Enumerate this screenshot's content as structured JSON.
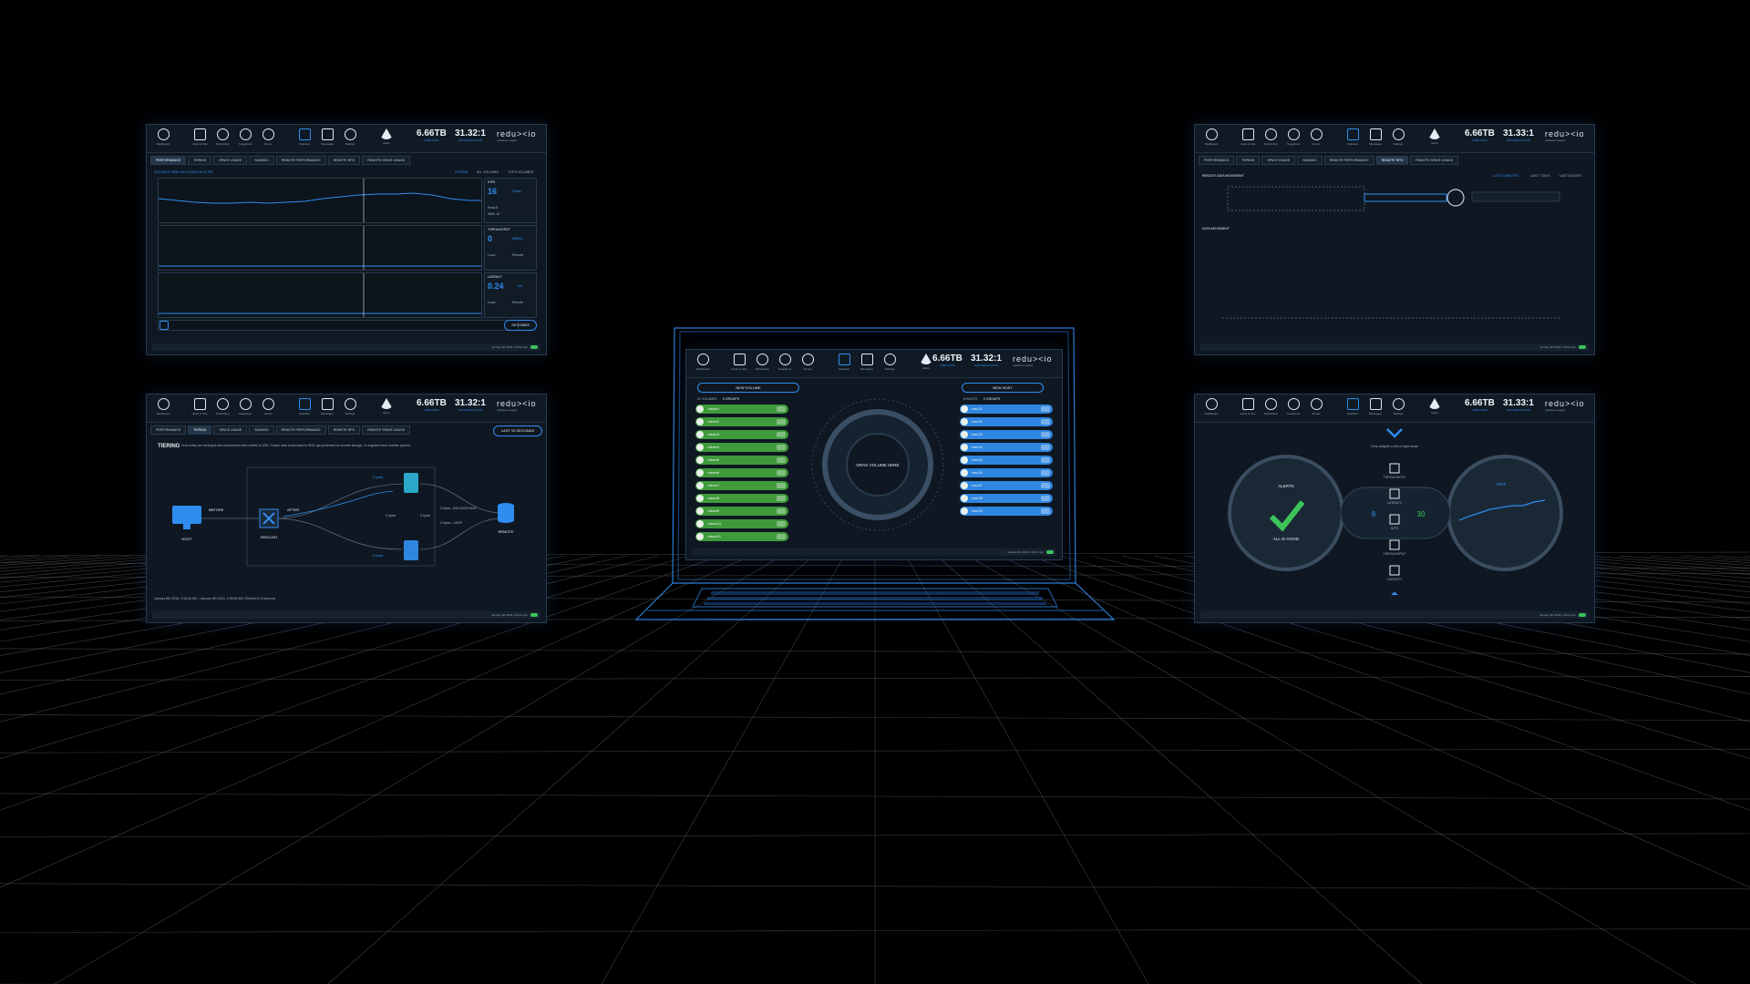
{
  "header": {
    "nav": [
      {
        "label": "Dashboard",
        "icon": "info-icon"
      },
      {
        "label": "Hosts & Vols",
        "icon": "monitor-icon"
      },
      {
        "label": "Scheduling",
        "icon": "clock-icon"
      },
      {
        "label": "Snapshots",
        "icon": "snapshot-icon"
      },
      {
        "label": "Clones",
        "icon": "clone-icon"
      },
      {
        "label": "Statistics",
        "icon": "stats-icon"
      },
      {
        "label": "Messages",
        "icon": "list-icon"
      },
      {
        "label": "Settings",
        "icon": "gear-icon"
      },
      {
        "label": "Alerts",
        "icon": "warning-icon"
      }
    ],
    "capacity_value": "6.66",
    "capacity_unit": "TB",
    "capacity_label": "USED DATA",
    "reduction_value": "31.32:1",
    "reduction_value_alt": "31.33:1",
    "reduction_label": "DATA REDUCTION",
    "brand": "redu><io",
    "user": "reduxio ▸ Logout"
  },
  "tabs": [
    "PERFORMANCE",
    "TIERING",
    "SPACE USAGE",
    "SAVINGS",
    "REMOTE PERFORMANCE",
    "REMOTE RPO",
    "REMOTE SPACE USAGE"
  ],
  "footer": {
    "timestamp": "January 8th 2018, 2:36:41 pm"
  },
  "perf_panel": {
    "subhead": "SECONDS VIEW   Jan 8 2018   2:36:11 PM",
    "filters": [
      "SYSTEM",
      "ALL VOLUMES",
      "TOP 5 VOLUMES"
    ],
    "charts": [
      {
        "title": "IOPS",
        "unit": "IO/sec",
        "value": "16",
        "legend": [
          "Read 8",
          "Write 16"
        ]
      },
      {
        "title": "THROUGHPUT",
        "unit": "MB/sec",
        "value": "0",
        "legend": [
          "Local",
          "Remote"
        ]
      },
      {
        "title": "LATENCY",
        "unit": "ms",
        "value": "0.24",
        "legend": [
          "Local",
          "Remote"
        ]
      }
    ],
    "range": "SECONDS"
  },
  "tier_panel": {
    "title": "TIERING",
    "desc": "Host writes are deduped and compressed then written to SSD. Colder data is demoted to HDD, get protected on remote storage, or migrated from another system.",
    "range": "LAST 15 SECONDS",
    "nodes": {
      "host": "HOST",
      "reduxio": "REDUXIO",
      "remote": "REMOTE"
    },
    "before": "BEFORE",
    "after": "AFTER",
    "flow_labels": [
      "0 bytes",
      "0 bytes",
      "0 bytes",
      "0 bytes",
      "0 bytes - BACKGROUND",
      "0 bytes - USER"
    ],
    "note": "January 8th 2018, 2:36:40 AM – January 8th 2018, 2:36:55 AM | Refresh in 5 seconds"
  },
  "hosts_panel": {
    "new_volume": "NEW VOLUME",
    "new_host": "NEW HOST",
    "vol_count": "11 VOLUMES",
    "groups_left": "0 GROUPS",
    "host_count": "8 HOSTS",
    "groups_right": "0 GROUPS",
    "drag_hint": "DRAG VOLUME HERE",
    "volumes": [
      "volume1",
      "volume2",
      "volume3",
      "volume4",
      "volume5",
      "volume6",
      "volume7",
      "volume8",
      "volume9",
      "volume10",
      "volume11"
    ],
    "hosts": [
      "host-01",
      "host-02",
      "host-03",
      "host-04",
      "host-05",
      "host-06",
      "host-07",
      "host-08",
      "host-09"
    ]
  },
  "remote_panel": {
    "title": "REMOTE DATA MOVEMENT",
    "ranges": [
      "LAST 5 MINUTES",
      "LAST 7 DAYS",
      "LAST 30 DAYS"
    ],
    "section": "DATA MOVEMENT"
  },
  "dash_panel": {
    "alerts": "ALERTS",
    "alerts_status": "ALL IS GOOD",
    "drop_hint": "Drop widgets to left or right areas",
    "widgets": [
      "THROUGHPUT",
      "LATENCY",
      "IOPS",
      "THROUGHPUT",
      "CAPACITY"
    ],
    "hosts": "8",
    "volumes": "30",
    "iops_title": "IOPS"
  },
  "colors": {
    "accent": "#2f8df0",
    "ok": "#3cc45a",
    "volume": "#3f9a3c",
    "host": "#2f86e0",
    "bg": "#0f1822"
  }
}
